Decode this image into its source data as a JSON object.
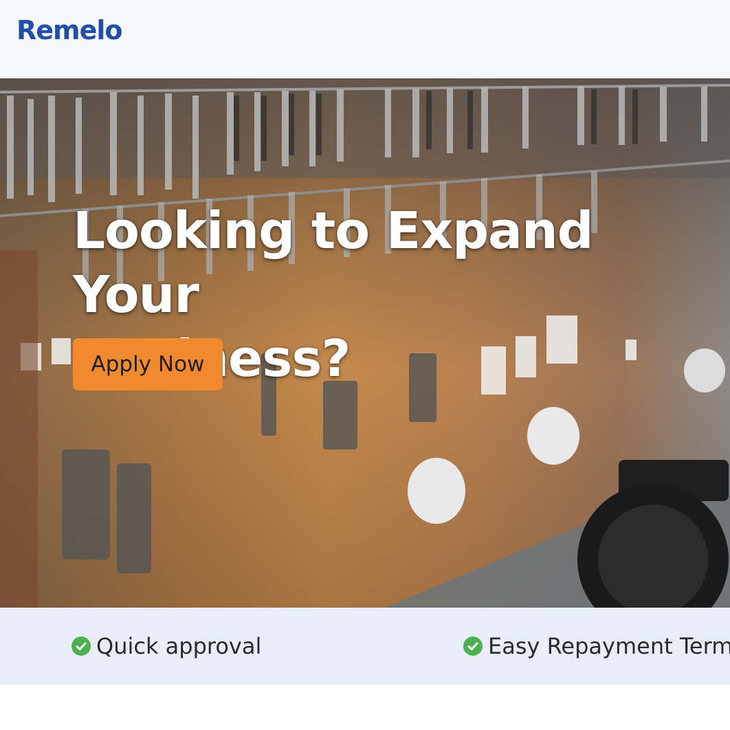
{
  "header": {
    "logo": "Remelo"
  },
  "hero": {
    "title_line1": "Looking to Expand Your",
    "title_line2": "Business?",
    "cta_label": "Apply Now",
    "cta_color": "#f08a2c"
  },
  "features": [
    {
      "icon": "check-circle-icon",
      "label": "Quick approval"
    },
    {
      "icon": "check-circle-icon",
      "label": "Easy Repayment Terms"
    }
  ],
  "colors": {
    "brand": "#1f4fa8",
    "accent": "#f08a2c",
    "check": "#4caf50",
    "strip": "#e8eef8"
  }
}
